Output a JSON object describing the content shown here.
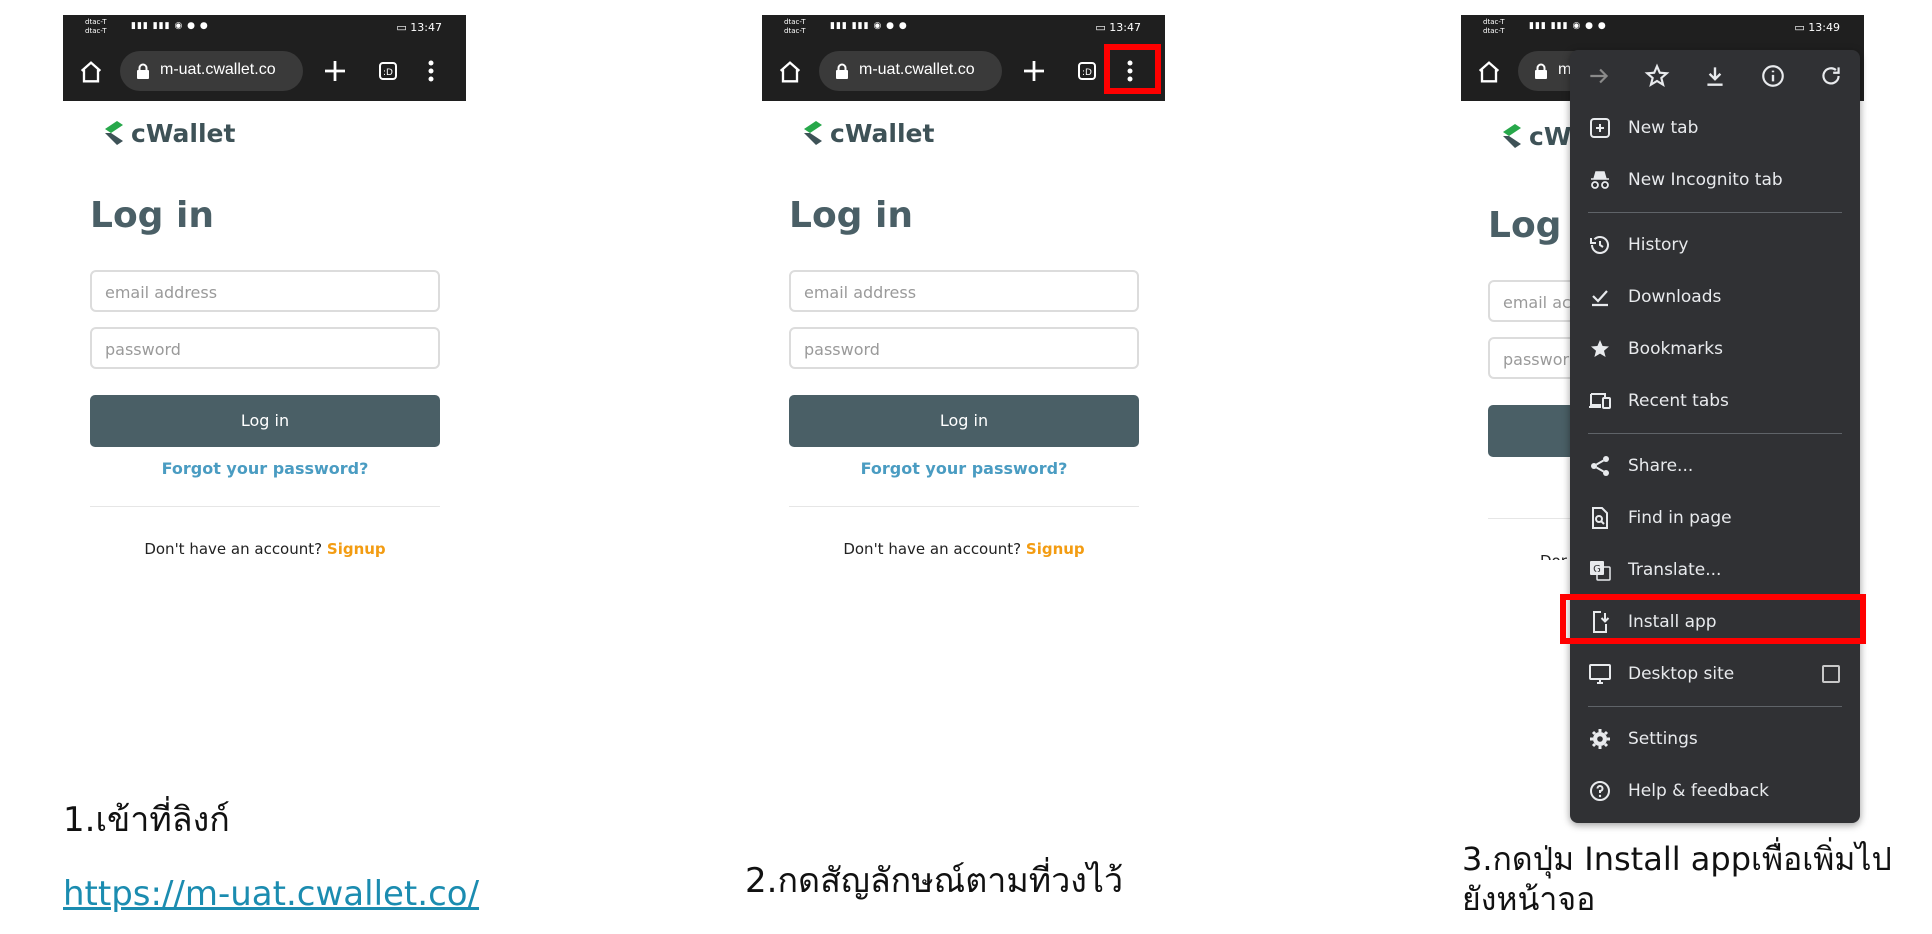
{
  "panels": [
    {
      "status": {
        "carrier_1": "dtac-T",
        "carrier_2": "dtac-T",
        "time": "13:47"
      },
      "url": "m-uat.cwallet.co"
    },
    {
      "status": {
        "carrier_1": "dtac-T",
        "carrier_2": "dtac-T",
        "time": "13:47"
      },
      "url": "m-uat.cwallet.co"
    },
    {
      "status": {
        "carrier_1": "dtac-T",
        "carrier_2": "dtac-T",
        "time": "13:49"
      },
      "url": "m"
    }
  ],
  "app": {
    "logo_text": "cWallet",
    "login_title": "Log in",
    "panel3_logo_text": "cW",
    "panel3_login_title": "Log i",
    "email_placeholder": "email address",
    "password_placeholder": "password",
    "panel3_email_placeholder": "email ac",
    "panel3_password_placeholder": "passwor",
    "login_button": "Log in",
    "forgot_password": "Forgot your password?",
    "no_account": "Don't have an account?",
    "panel3_no_account": "Dor",
    "signup": "Signup"
  },
  "menu": {
    "items": [
      {
        "label": "New tab",
        "icon": "new-tab-icon"
      },
      {
        "label": "New Incognito tab",
        "icon": "incognito-icon"
      },
      {
        "label": "History",
        "icon": "history-icon"
      },
      {
        "label": "Downloads",
        "icon": "downloads-check-icon"
      },
      {
        "label": "Bookmarks",
        "icon": "star-filled-icon"
      },
      {
        "label": "Recent tabs",
        "icon": "devices-icon"
      },
      {
        "label": "Share...",
        "icon": "share-icon"
      },
      {
        "label": "Find in page",
        "icon": "find-in-page-icon"
      },
      {
        "label": "Translate...",
        "icon": "translate-icon"
      },
      {
        "label": "Install app",
        "icon": "install-app-icon"
      },
      {
        "label": "Desktop site",
        "icon": "desktop-icon"
      },
      {
        "label": "Settings",
        "icon": "settings-icon"
      },
      {
        "label": "Help & feedback",
        "icon": "help-icon"
      }
    ],
    "top_icons": [
      "forward-arrow-icon",
      "star-outline-icon",
      "download-icon",
      "info-icon",
      "refresh-icon"
    ]
  },
  "captions": {
    "step1": "1.เข้าที่ลิงก์",
    "step1_link": "https://m-uat.cwallet.co/",
    "step2": "2.กดสัญลักษณ์ตามที่วงไว้",
    "step3_line1": "3.กดปุ่ม Install appเพื่อเพิ่มไป",
    "step3_line2": "ยังหน้าจอ"
  },
  "colors": {
    "highlight": "#ff0000",
    "brand_dark": "#4a5f66",
    "link_blue": "#4a9cc2",
    "signup_orange": "#f39c12",
    "menu_bg": "#303134",
    "logo_green": "#27a84a"
  }
}
